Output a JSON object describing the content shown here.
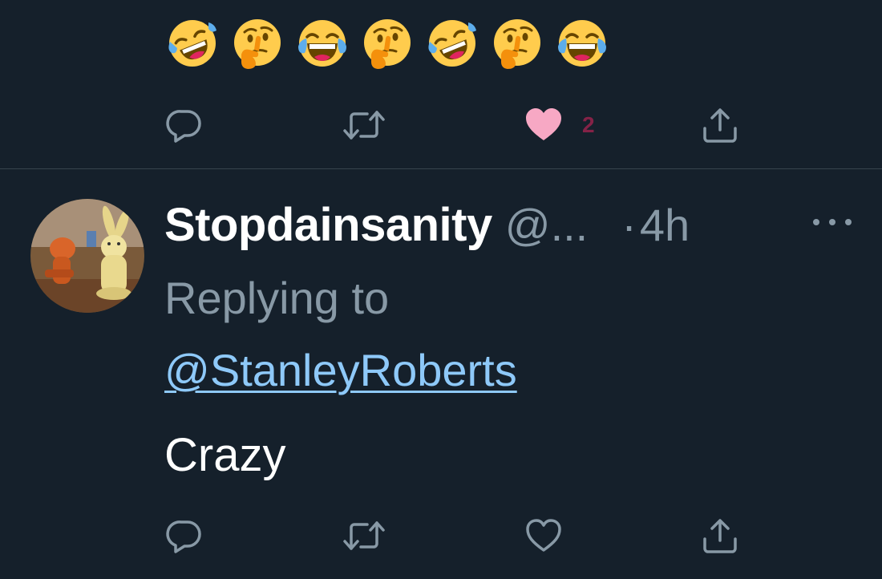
{
  "first_tweet": {
    "emojis": [
      "rolling-on-floor-laughing",
      "thinking-face",
      "tears-of-joy",
      "thinking-face",
      "rolling-on-floor-laughing",
      "thinking-face",
      "tears-of-joy"
    ],
    "actions": {
      "reply_icon": "reply-bubble-icon",
      "retweet_icon": "retweet-icon",
      "like_icon": "heart-filled-icon",
      "like_count": "2",
      "share_icon": "share-icon"
    }
  },
  "reply_tweet": {
    "display_name": "Stopdainsanity",
    "handle": "@...",
    "dot": "·",
    "timestamp": "4h",
    "replying_label": "Replying to",
    "mention": "@StanleyRoberts",
    "text": "Crazy",
    "actions": {
      "reply_icon": "reply-bubble-icon",
      "retweet_icon": "retweet-icon",
      "like_icon": "heart-outline-icon",
      "share_icon": "share-icon"
    }
  },
  "colors": {
    "background": "#15202b",
    "divider": "#38444d",
    "secondary_text": "#8899a6",
    "link": "#8ec9f9",
    "like_active": "#e0245e",
    "primary_text": "#ffffff"
  }
}
